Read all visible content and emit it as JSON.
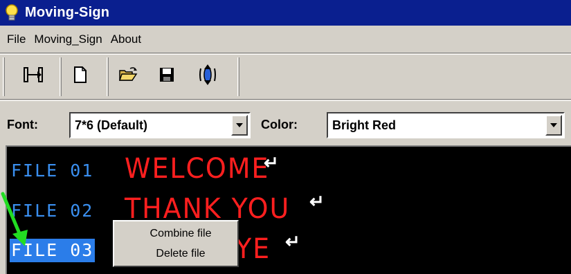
{
  "window": {
    "title": "Moving-Sign"
  },
  "menubar": {
    "items": [
      "File",
      "Moving_Sign",
      "About"
    ]
  },
  "toolbar": {
    "buttons": [
      "insert-icon",
      "new-file-icon",
      "open-folder-icon",
      "save-icon",
      "send-icon"
    ]
  },
  "font_bar": {
    "font_label": "Font:",
    "font_value": "7*6 (Default)",
    "color_label": "Color:",
    "color_value": "Bright Red"
  },
  "display": {
    "rows": [
      {
        "file": "FILE 01",
        "message": "WELCOME",
        "selected": false
      },
      {
        "file": "FILE 02",
        "message": "THANK YOU",
        "selected": false
      },
      {
        "file": "FILE 03",
        "message": "YE",
        "selected": true
      }
    ]
  },
  "context_menu": {
    "items": [
      "Combine file",
      "Delete file"
    ]
  },
  "colors": {
    "title_bar": "#0a1f8f",
    "file_label": "#3a8ff0",
    "message_text": "#ff1f1f",
    "selection": "#2b7de9",
    "annotation_arrow": "#22dd22"
  }
}
